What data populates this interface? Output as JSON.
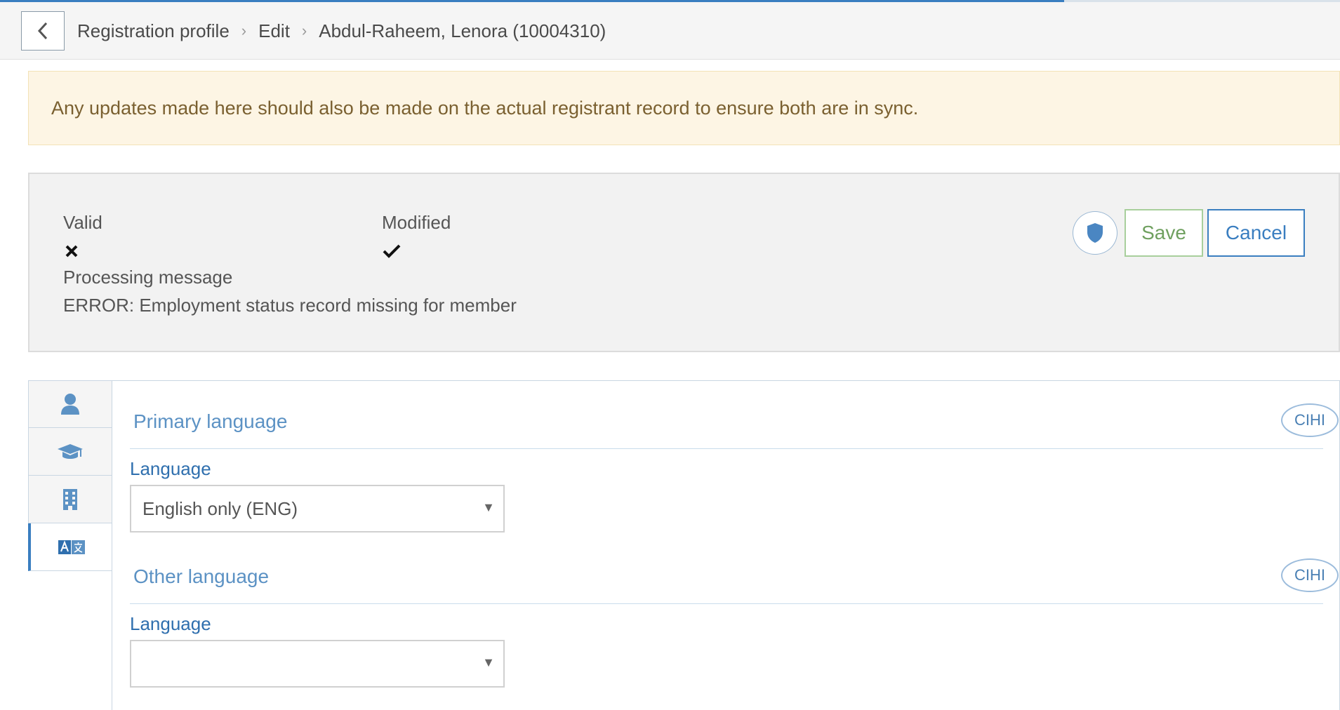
{
  "breadcrumb": {
    "items": [
      "Registration profile",
      "Edit",
      "Abdul-Raheem, Lenora (10004310)"
    ],
    "separator": "›"
  },
  "alert": {
    "text": "Any updates made here should also be made on the actual registrant record to ensure both are in sync."
  },
  "status": {
    "valid_label": "Valid",
    "valid_value": "false",
    "modified_label": "Modified",
    "modified_value": "true",
    "processing_label": "Processing message",
    "processing_message": "ERROR: Employment status record missing for member"
  },
  "actions": {
    "save_label": "Save",
    "cancel_label": "Cancel"
  },
  "tabs": [
    {
      "icon": "person-icon",
      "active": false
    },
    {
      "icon": "graduation-cap-icon",
      "active": false
    },
    {
      "icon": "building-icon",
      "active": false
    },
    {
      "icon": "language-icon",
      "active": true
    }
  ],
  "sections": {
    "primary": {
      "title": "Primary language",
      "badge": "CIHI",
      "field_label": "Language",
      "value": "English only (ENG)"
    },
    "other": {
      "title": "Other language",
      "badge": "CIHI",
      "field_label": "Language",
      "value": ""
    }
  },
  "colors": {
    "accent": "#3a7ec0",
    "save_green": "#6fa05f",
    "alert_bg": "#fdf5e4",
    "section_title": "#5c92c4"
  }
}
